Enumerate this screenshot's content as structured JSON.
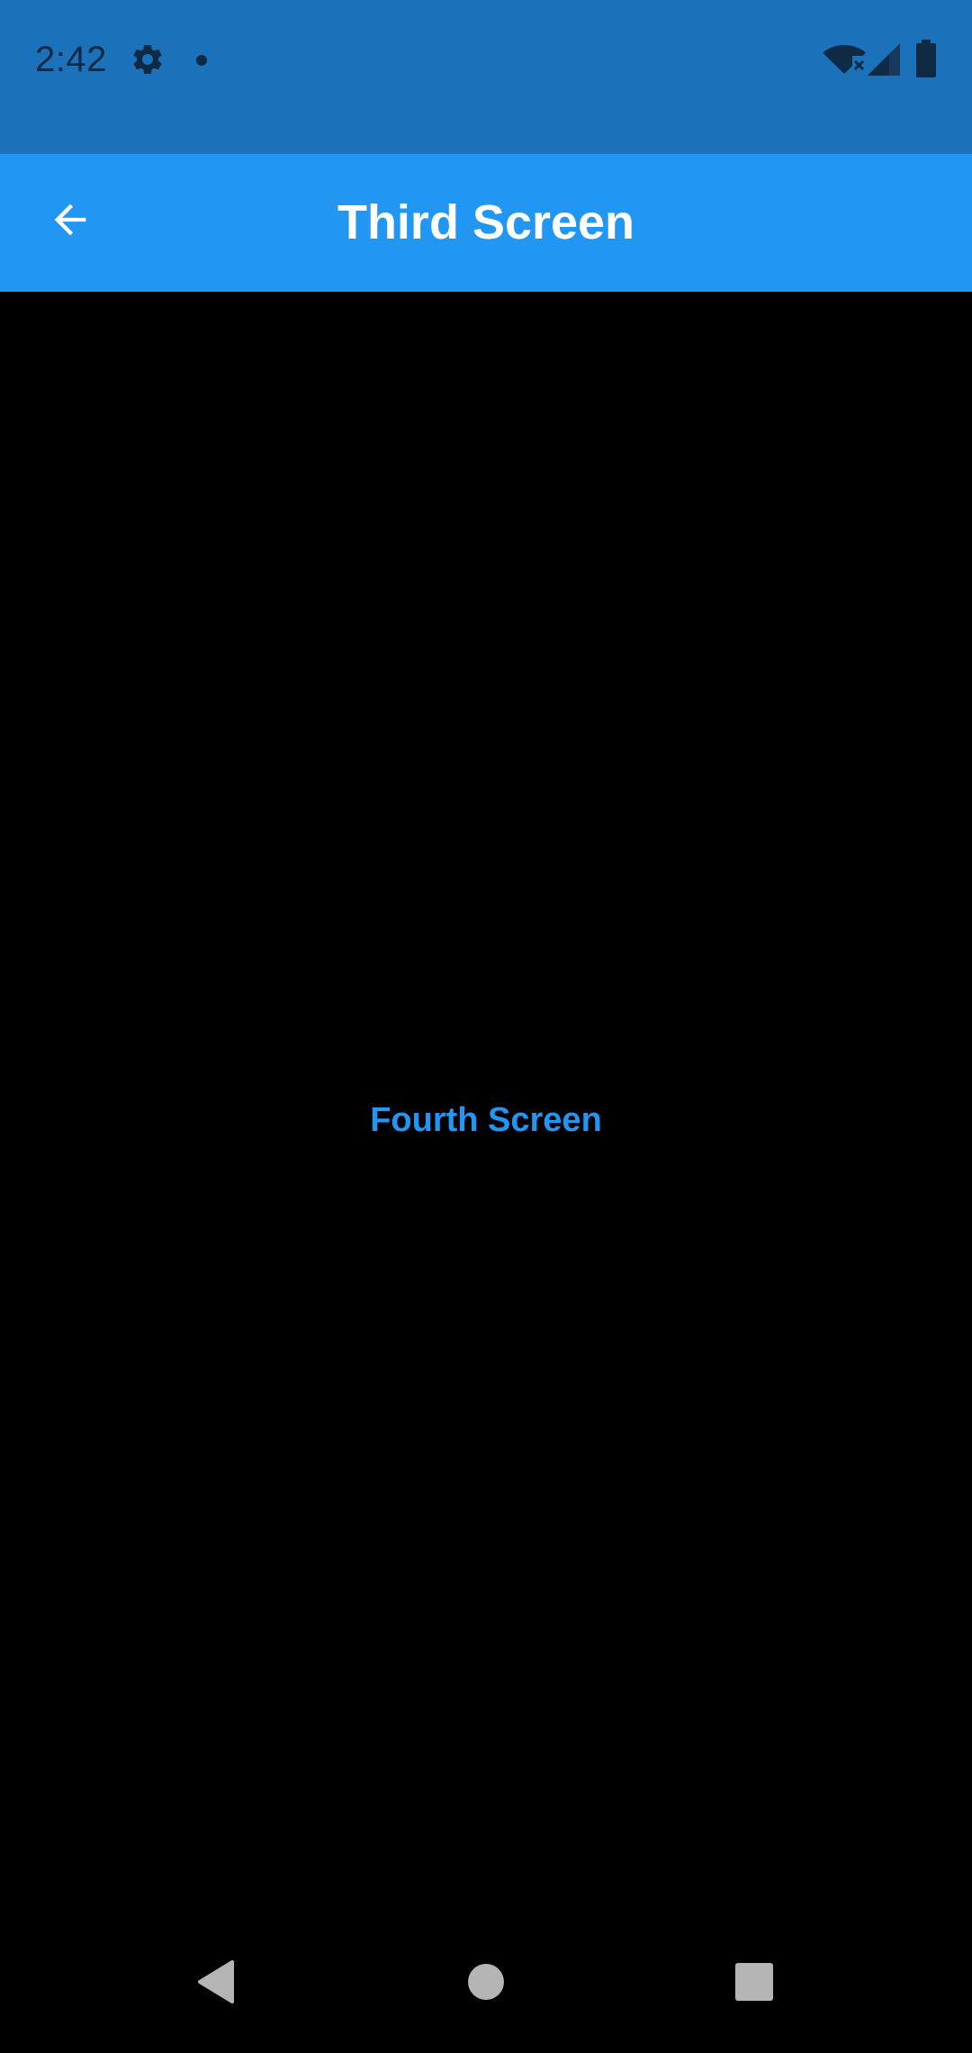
{
  "status_bar": {
    "time": "2:42",
    "icons": [
      "gear-icon",
      "notification-dot-icon",
      "wifi-off-icon",
      "signal-icon",
      "battery-icon"
    ],
    "background": "#1b72bb"
  },
  "app_bar": {
    "title": "Third Screen",
    "back_icon": "arrow-back-icon",
    "background": "#2296f3"
  },
  "content": {
    "button_label": "Fourth Screen",
    "accent": "#2196f3",
    "background": "#000000"
  },
  "nav_bar": {
    "icons": [
      "back-triangle-icon",
      "home-circle-icon",
      "recents-square-icon"
    ]
  }
}
